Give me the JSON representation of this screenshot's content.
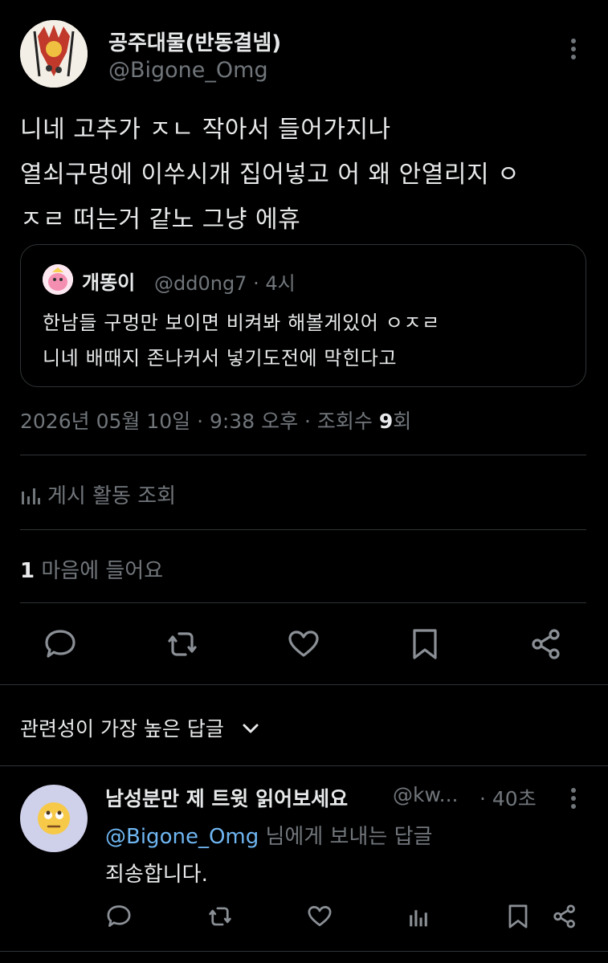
{
  "tweet": {
    "author_name": "공주대물(반동결넴)",
    "author_handle": "@Bigone_Omg",
    "lines": [
      "니네 고추가 ㅈㄴ 작아서 들어가지나",
      "열쇠구멍에 이쑤시개 집어넣고 어 왜 안열리지 ㅇ",
      "ㅈㄹ 떠는거 같노 그냥 에휴"
    ],
    "date_time": "2026년 05월 10일 · 9:38 오후 · 조회수 ",
    "views_count": "9",
    "views_suffix": "회"
  },
  "quote": {
    "author_name": "개똥이",
    "author_meta": "@dd0ng7 · 4시",
    "lines": [
      "한남들 구멍만 보이면 비켜봐 해볼게있어 ㅇㅈㄹ",
      "니네 배때지 존나커서 넣기도전에 막힌다고"
    ]
  },
  "activity": {
    "label": "게시 활동 조회"
  },
  "likes": {
    "count": "1",
    "label": " 마음에 들어요"
  },
  "sort": {
    "label": "관련성이 가장 높은 답글"
  },
  "reply": {
    "author_name": "남성분만 제 트윗 읽어보세요",
    "author_handle": "@kw...",
    "time": "· 40초",
    "replying_mention": "@Bigone_Omg",
    "replying_suffix": " 님에게 보내는 답글",
    "text": "죄송합니다.",
    "avatar_emoji": "🙄"
  },
  "colors": {
    "background": "#000000",
    "text_primary": "#e7e9ea",
    "text_secondary": "#71767b",
    "link": "#6fb6f2",
    "divider": "#2f3336"
  },
  "icons": [
    "more-icon",
    "comment-icon",
    "retweet-icon",
    "like-icon",
    "bookmark-icon",
    "share-icon",
    "analytics-icon",
    "chevron-down-icon"
  ]
}
